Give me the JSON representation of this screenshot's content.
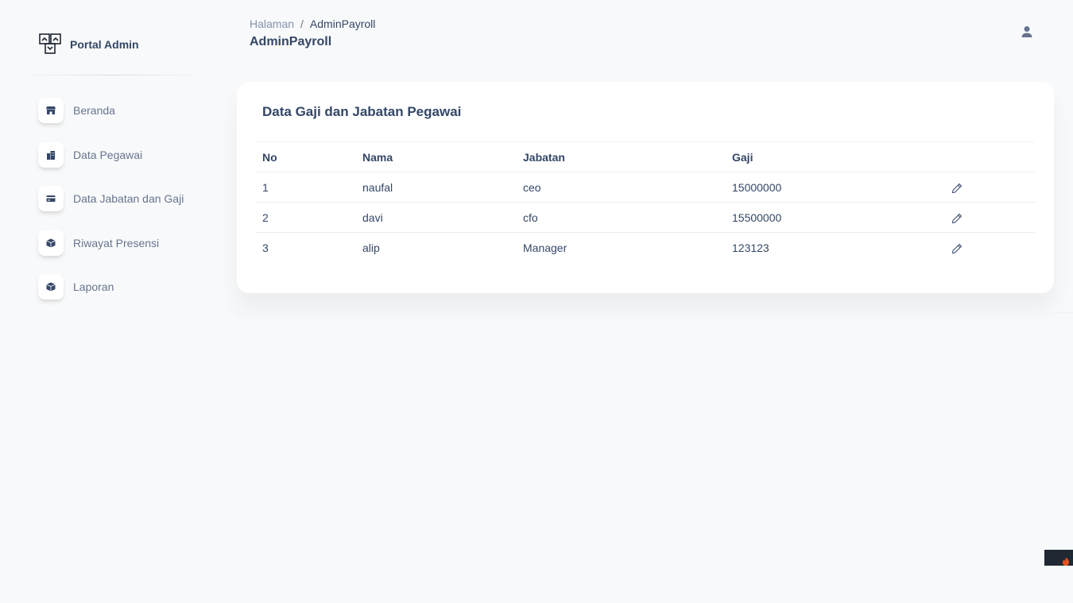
{
  "brand": {
    "name": "Portal Admin"
  },
  "sidebar": {
    "items": [
      {
        "label": "Beranda",
        "icon": "shop-icon"
      },
      {
        "label": "Data Pegawai",
        "icon": "office-icon"
      },
      {
        "label": "Data Jabatan dan Gaji",
        "icon": "credit-card-icon"
      },
      {
        "label": "Riwayat Presensi",
        "icon": "box-icon"
      },
      {
        "label": "Laporan",
        "icon": "box-icon"
      }
    ]
  },
  "header": {
    "breadcrumb": {
      "root": "Halaman",
      "separator": "/",
      "current": "AdminPayroll"
    },
    "title": "AdminPayroll",
    "user_icon": "user-icon"
  },
  "card": {
    "title": "Data Gaji dan Jabatan Pegawai",
    "table": {
      "columns": [
        "No",
        "Nama",
        "Jabatan",
        "Gaji",
        ""
      ],
      "rows": [
        {
          "no": "1",
          "nama": "naufal",
          "jabatan": "ceo",
          "gaji": "15000000"
        },
        {
          "no": "2",
          "nama": "davi",
          "jabatan": "cfo",
          "gaji": "15500000"
        },
        {
          "no": "3",
          "nama": "alip",
          "jabatan": "Manager",
          "gaji": "123123"
        }
      ],
      "row_action_icon": "pencil-icon"
    }
  },
  "colors": {
    "text": "#344767",
    "muted": "#67748e",
    "background": "#f8f9fa",
    "card": "#ffffff"
  }
}
